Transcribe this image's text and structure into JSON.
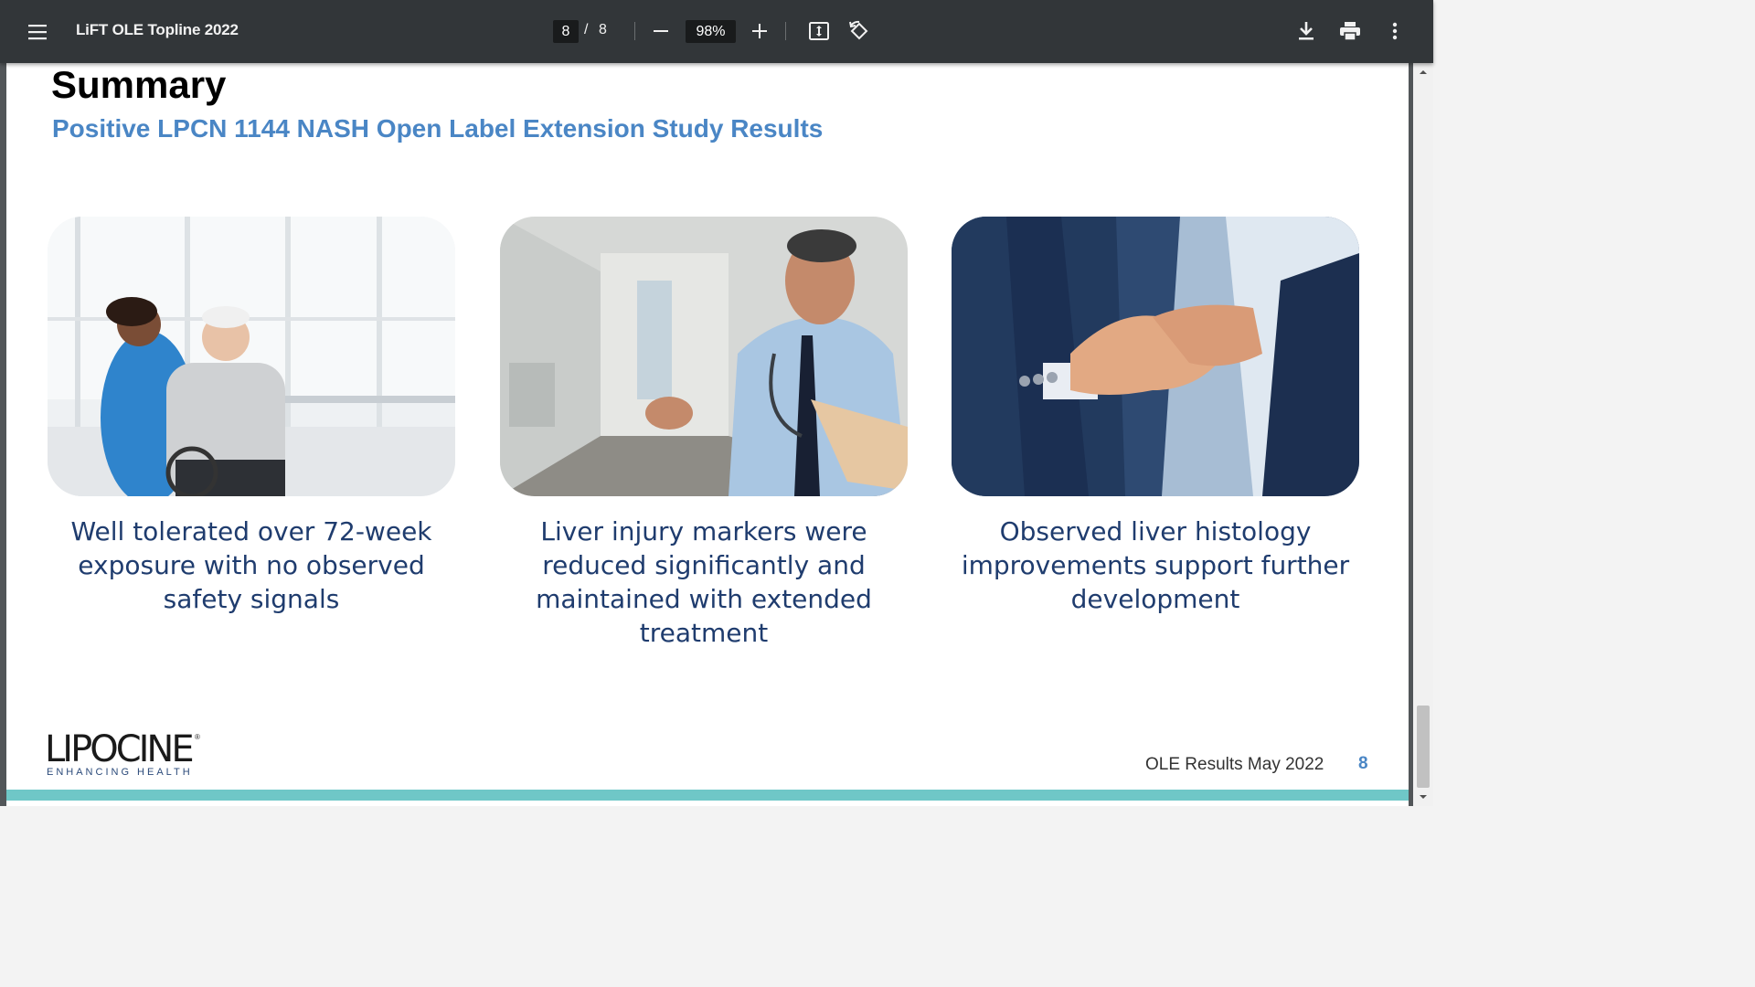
{
  "toolbar": {
    "title": "LiFT OLE Topline 2022",
    "current_page": "8",
    "page_separator": "/",
    "total_pages": "8",
    "zoom": "98%",
    "icons": [
      "menu-icon",
      "zoom-out-icon",
      "zoom-in-icon",
      "fit-page-icon",
      "rotate-icon",
      "download-icon",
      "print-icon",
      "more-vert-icon"
    ]
  },
  "slide": {
    "title": "Summary",
    "subtitle": "Positive LPCN 1144 NASH Open Label Extension Study Results",
    "cards": [
      {
        "image": "nurse-with-elderly-patient-photo",
        "caption": "Well tolerated over 72-week exposure with no observed safety signals"
      },
      {
        "image": "smiling-doctor-photo",
        "caption": "Liver injury markers were reduced significantly and maintained with extended treatment"
      },
      {
        "image": "handshake-photo",
        "caption": "Observed liver histology improvements support further development"
      }
    ],
    "logo": {
      "name": "LIPOCINE",
      "reg_mark": "®",
      "tagline": "ENHANCING HEALTH"
    },
    "footer_text": "OLE Results May 2022",
    "page_number": "8",
    "colors": {
      "subtitle": "#4a86c5",
      "caption": "#1f3c6e",
      "footer_bar": "#6fc7c7",
      "toolbar": "#323639"
    }
  }
}
